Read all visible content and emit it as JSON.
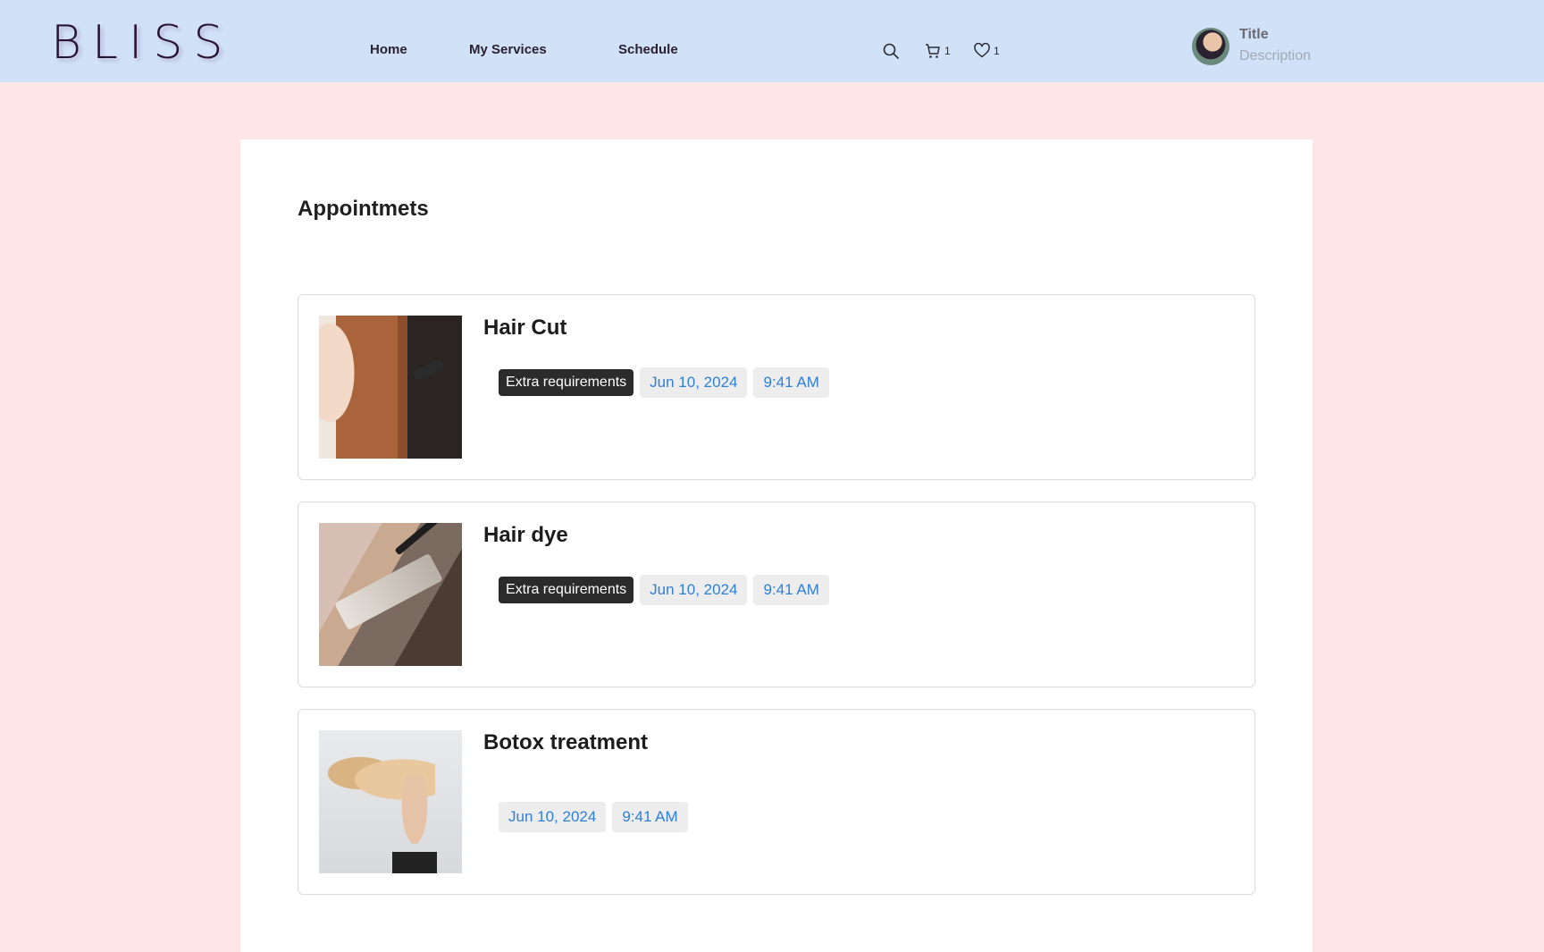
{
  "header": {
    "logo": "BLISS",
    "nav": [
      {
        "label": "Home"
      },
      {
        "label": "My Services"
      },
      {
        "label": "Schedule"
      }
    ],
    "icons": {
      "search": "search-icon",
      "cart": {
        "icon": "cart-icon",
        "count": "1"
      },
      "favorites": {
        "icon": "heart-icon",
        "count": "1"
      }
    },
    "user": {
      "title": "Title",
      "description": "Description"
    }
  },
  "main": {
    "title": "Appointmets",
    "appointments": [
      {
        "name": "Hair Cut",
        "extra": "Extra requirements",
        "date": "Jun 10, 2024",
        "time": "9:41 AM"
      },
      {
        "name": "Hair dye",
        "extra": "Extra requirements",
        "date": "Jun 10, 2024",
        "time": "9:41 AM"
      },
      {
        "name": "Botox treatment",
        "date": "Jun 10, 2024",
        "time": "9:41 AM"
      }
    ]
  },
  "colors": {
    "page_bg": "#fee6e6",
    "header_bg": "#d1e2f8",
    "chip_dark": "#2b2b2b",
    "chip_light": "#ededed",
    "chip_text_blue": "#2f7fd6"
  }
}
